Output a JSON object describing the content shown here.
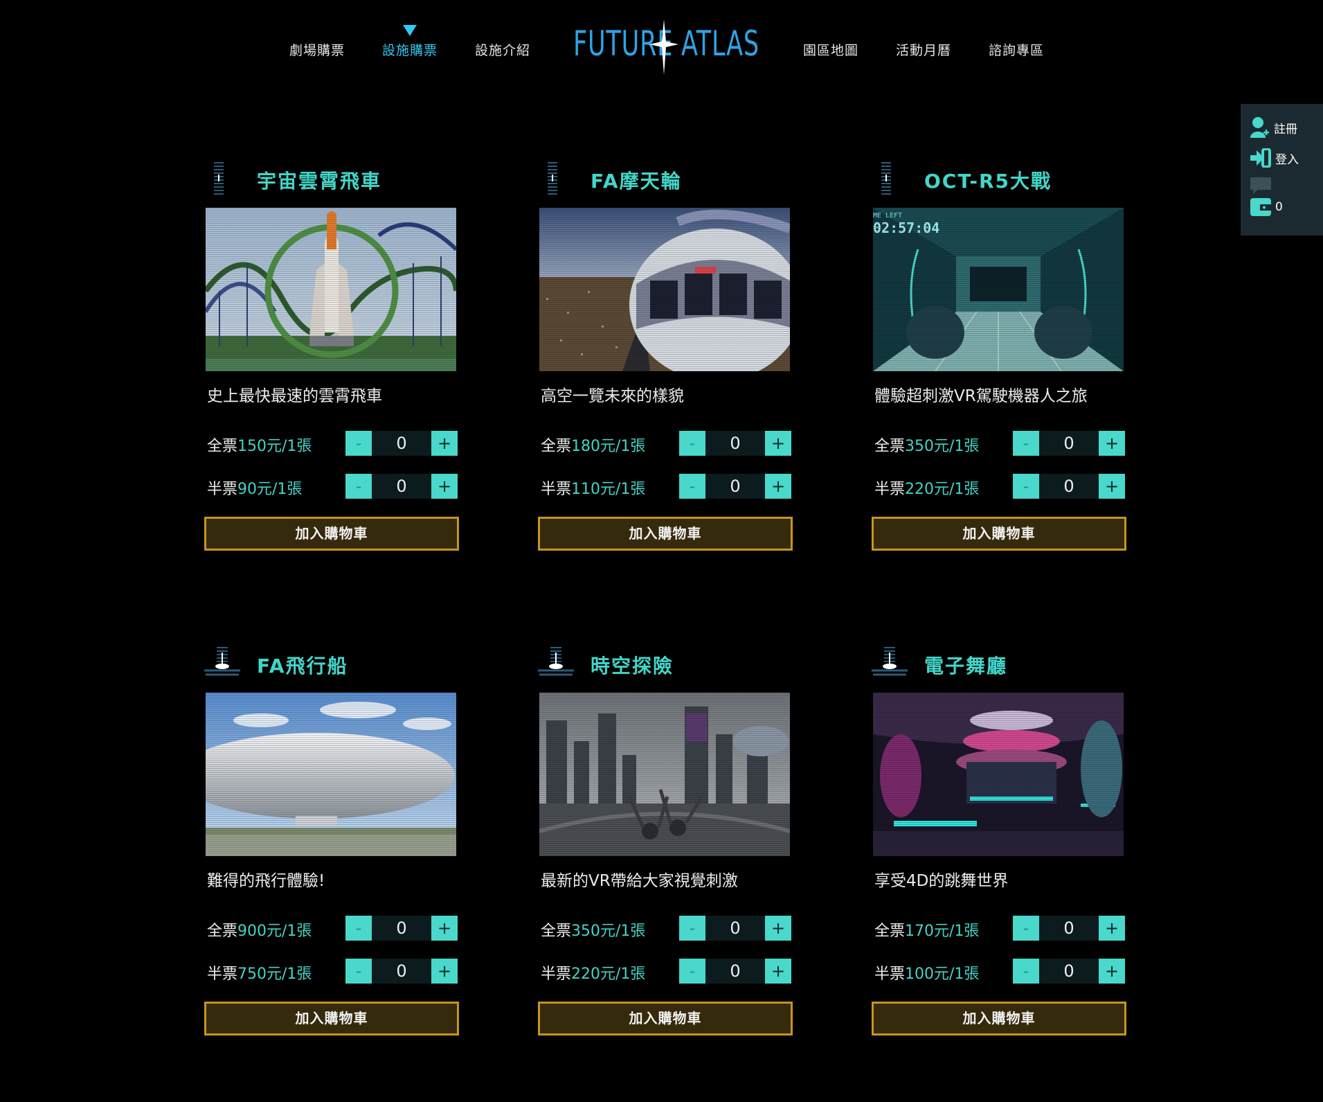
{
  "nav": {
    "items": [
      {
        "label": "劇場購票"
      },
      {
        "label": "設施購票"
      },
      {
        "label": "設施介紹"
      },
      {
        "label": "園區地圖"
      },
      {
        "label": "活動月曆"
      },
      {
        "label": "諮詢專區"
      }
    ],
    "active_index": 1,
    "logo_left": "FUTURE",
    "logo_right": "ATLAS"
  },
  "side_panel": {
    "register_label": "註冊",
    "login_label": "登入",
    "cart_count": "0"
  },
  "colors": {
    "accent_teal": "#42d6c9",
    "nav_active": "#33c7f2",
    "button_border_gold": "#c6951f",
    "button_fill": "#362a0c"
  },
  "cards": [
    {
      "title": "宇宙雲霄飛車",
      "desc": "史上最快最速的雲霄飛車",
      "full_prefix": "全票",
      "full_price": "150元/1張",
      "half_prefix": "半票",
      "half_price": "90元/1張",
      "full_qty": "0",
      "half_qty": "0",
      "minus": "-",
      "plus": "+",
      "cart_label": "加入購物車"
    },
    {
      "title": "FA摩天輪",
      "desc": "高空一覽未來的樣貌",
      "full_prefix": "全票",
      "full_price": "180元/1張",
      "half_prefix": "半票",
      "half_price": "110元/1張",
      "full_qty": "0",
      "half_qty": "0",
      "minus": "-",
      "plus": "+",
      "cart_label": "加入購物車"
    },
    {
      "title": "OCT-R5大戰",
      "desc": "體驗超刺激VR駕駛機器人之旅",
      "full_prefix": "全票",
      "full_price": "350元/1張",
      "half_prefix": "半票",
      "half_price": "220元/1張",
      "full_qty": "0",
      "half_qty": "0",
      "minus": "-",
      "plus": "+",
      "cart_label": "加入購物車",
      "image_hud_text": "ME LEFT 02:57:04"
    },
    {
      "title": "FA飛行船",
      "desc": "難得的飛行體驗!",
      "full_prefix": "全票",
      "full_price": "900元/1張",
      "half_prefix": "半票",
      "half_price": "750元/1張",
      "full_qty": "0",
      "half_qty": "0",
      "minus": "-",
      "plus": "+",
      "cart_label": "加入購物車"
    },
    {
      "title": "時空探險",
      "desc": "最新的VR帶給大家視覺刺激",
      "full_prefix": "全票",
      "full_price": "350元/1張",
      "half_prefix": "半票",
      "half_price": "220元/1張",
      "full_qty": "0",
      "half_qty": "0",
      "minus": "-",
      "plus": "+",
      "cart_label": "加入購物車"
    },
    {
      "title": "電子舞廳",
      "desc": "享受4D的跳舞世界",
      "full_prefix": "全票",
      "full_price": "170元/1張",
      "half_prefix": "半票",
      "half_price": "100元/1張",
      "full_qty": "0",
      "half_qty": "0",
      "minus": "-",
      "plus": "+",
      "cart_label": "加入購物車"
    }
  ]
}
